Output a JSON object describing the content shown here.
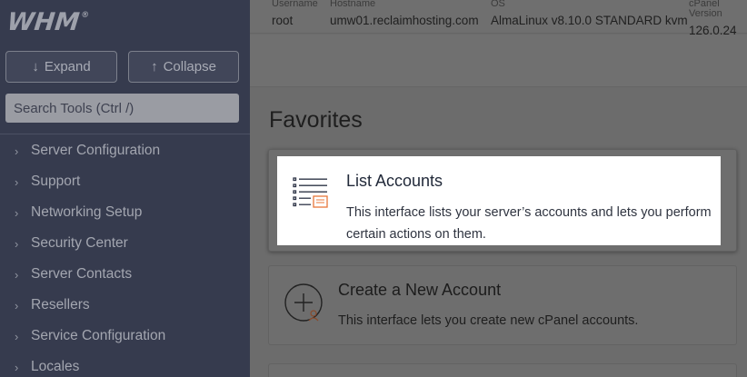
{
  "sidebar": {
    "logo": "WHM",
    "expand_label": "Expand",
    "collapse_label": "Collapse",
    "search_placeholder": "Search Tools (Ctrl /)",
    "items": [
      {
        "label": "Server Configuration"
      },
      {
        "label": "Support"
      },
      {
        "label": "Networking Setup"
      },
      {
        "label": "Security Center"
      },
      {
        "label": "Server Contacts"
      },
      {
        "label": "Resellers"
      },
      {
        "label": "Service Configuration"
      },
      {
        "label": "Locales"
      }
    ]
  },
  "server_info": {
    "username_header": "Username",
    "username": "root",
    "hostname_header": "Hostname",
    "hostname": "umw01.reclaimhosting.com",
    "os_header": "OS",
    "os": "AlmaLinux v8.10.0 STANDARD kvm",
    "version_header": "cPanel Version",
    "version": "126.0.24"
  },
  "favorites": {
    "title": "Favorites",
    "cards": [
      {
        "title": "List Accounts",
        "description": "This interface lists your server’s accounts and lets you perform certain actions on them.",
        "icon": "list-accounts-icon"
      },
      {
        "title": "Create a New Account",
        "description": "This interface lets you create new cPanel accounts.",
        "icon": "create-account-icon"
      }
    ]
  },
  "colors": {
    "sidebar_bg": "#363b4e",
    "overlay_gray": "#6f6f6f",
    "highlight_card": "#ffffff",
    "icon_accent": "#e8773a"
  }
}
